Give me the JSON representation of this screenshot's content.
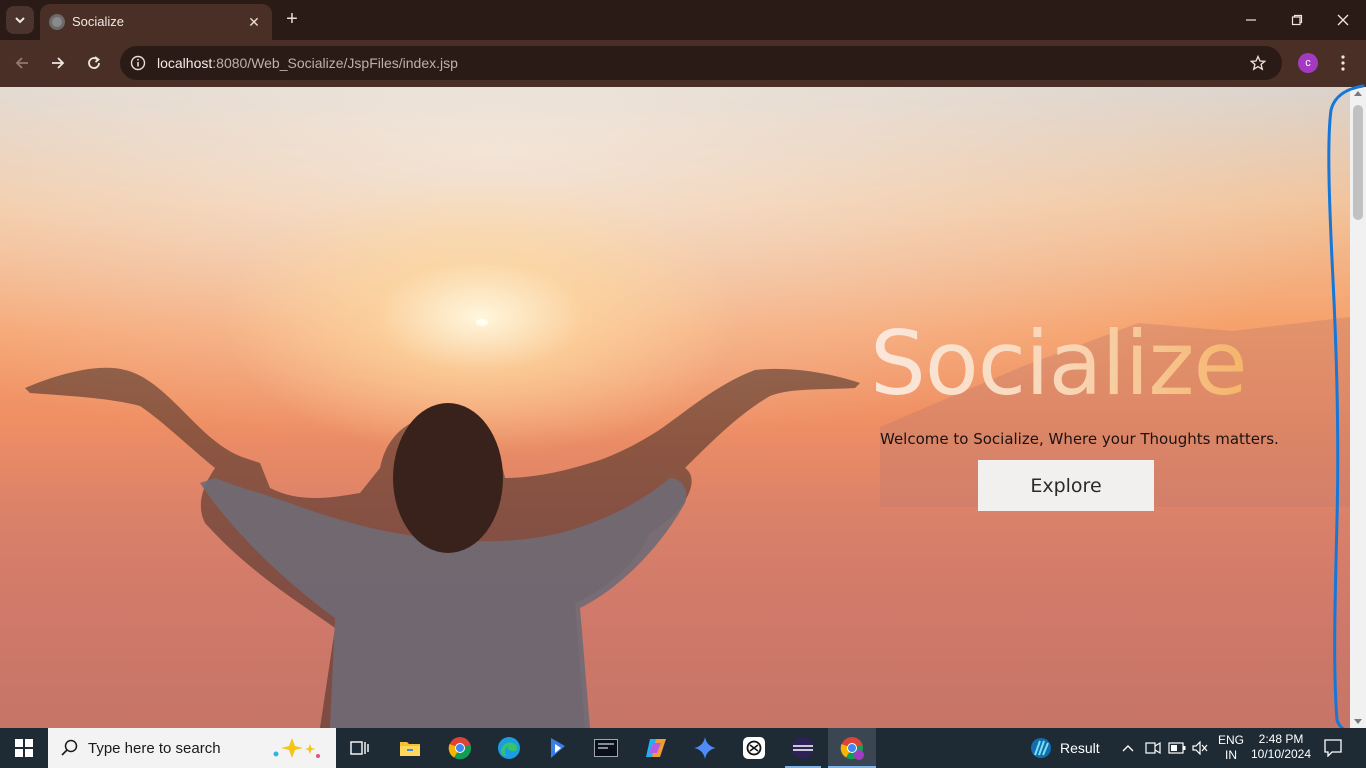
{
  "browser": {
    "tab": {
      "title": "Socialize"
    },
    "url": {
      "host": "localhost",
      "path": ":8080/Web_Socialize/JspFiles/index.jsp"
    },
    "profile_initial": "c"
  },
  "hero": {
    "title": "Socialize",
    "subtitle": "Welcome to Socialize, Where your Thoughts matters.",
    "explore_label": "Explore"
  },
  "taskbar": {
    "search_placeholder": "Type here to search",
    "result_label": "Result",
    "language_top": "ENG",
    "language_bottom": "IN",
    "time": "2:48 PM",
    "date": "10/10/2024"
  },
  "colors": {
    "annotation_stroke": "#1677d9",
    "taskbar_bg": "#1e2a34",
    "tabstrip_bg": "#2b1b17"
  }
}
